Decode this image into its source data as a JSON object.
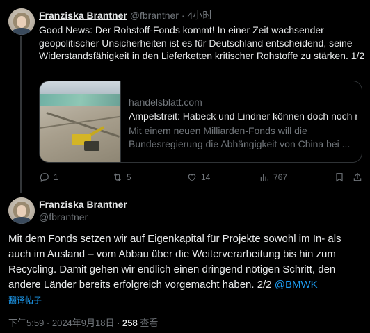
{
  "post1": {
    "display_name": "Franziska Brantner",
    "handle": "@fbrantner",
    "separator": "·",
    "time": "4小时",
    "text": "Good News: Der Rohstoff-Fonds kommt! In einer Zeit wachsender geopolitischer Unsicherheiten ist es für Deutschland entscheidend, seine Widerstandsfähigkeit in den Lieferketten kritischer Rohstoffe zu stärken. 1/2",
    "card": {
      "domain": "handelsblatt.com",
      "title": "Ampelstreit: Habeck und Lindner können doch noch mit",
      "description": "Mit einem neuen Milliarden-Fonds will die Bundesregierung die Abhängigkeit von China bei ..."
    },
    "actions": {
      "replies": "1",
      "reposts": "5",
      "likes": "14",
      "views": "767"
    }
  },
  "post2": {
    "display_name": "Franziska Brantner",
    "handle": "@fbrantner",
    "text": "Mit dem Fonds setzen wir auf Eigenkapital für Projekte sowohl im In- als auch im Ausland – vom Abbau über die Weiterverarbeitung bis hin zum Recycling. Damit gehen wir endlich einen dringend nötigen Schritt, den andere Länder bereits erfolgreich vorgemacht haben. 2/2",
    "mention": "@BMWK",
    "translate_label": "翻译帖子",
    "timestamp": "下午5:59 · 2024年9月18日 · ",
    "views_count": "258",
    "views_label": " 查看"
  },
  "icons": [
    "reply-icon",
    "repost-icon",
    "like-icon",
    "views-icon",
    "bookmark-icon",
    "share-icon",
    "more-icon"
  ],
  "colors": {
    "background": "#000000",
    "text": "#e7e9ea",
    "muted": "#71767b",
    "link": "#1d9bf0",
    "border": "#2f3336"
  }
}
